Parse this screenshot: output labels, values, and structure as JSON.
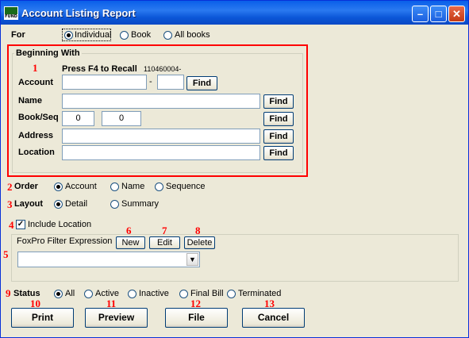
{
  "window": {
    "title": "Account Listing Report",
    "icon_text": "FUND",
    "minimize_icon": "minimize-icon",
    "maximize_icon": "maximize-icon",
    "close_icon": "close-icon"
  },
  "for": {
    "label": "For",
    "options": [
      "Individual",
      "Book",
      "All books"
    ],
    "selected": "Individual"
  },
  "beginning_with": {
    "title": "Beginning With",
    "hint": "Press F4 to Recall",
    "recall_value": "110460004-",
    "account_label": "Account",
    "account_dash": "-",
    "name_label": "Name",
    "bookseq_label": "Book/Seq",
    "book_value": "0",
    "seq_value": "0",
    "address_label": "Address",
    "location_label": "Location",
    "find_label": "Find"
  },
  "order": {
    "label": "Order",
    "options": [
      "Account",
      "Name",
      "Sequence"
    ],
    "selected": "Account"
  },
  "layout": {
    "label": "Layout",
    "options": [
      "Detail",
      "Summary"
    ],
    "selected": "Detail"
  },
  "include_location": {
    "label": "Include Location",
    "checked": true
  },
  "filter": {
    "label": "FoxPro Filter Expression",
    "new_label": "New",
    "edit_label": "Edit",
    "delete_label": "Delete",
    "value": ""
  },
  "status": {
    "label": "Status",
    "options": [
      "All",
      "Active",
      "Inactive",
      "Final Bill",
      "Terminated"
    ],
    "selected": "All"
  },
  "actions": {
    "print": "Print",
    "preview": "Preview",
    "file": "File",
    "cancel": "Cancel"
  },
  "markers": [
    "1",
    "2",
    "3",
    "4",
    "5",
    "6",
    "7",
    "8",
    "9",
    "10",
    "11",
    "12",
    "13"
  ]
}
